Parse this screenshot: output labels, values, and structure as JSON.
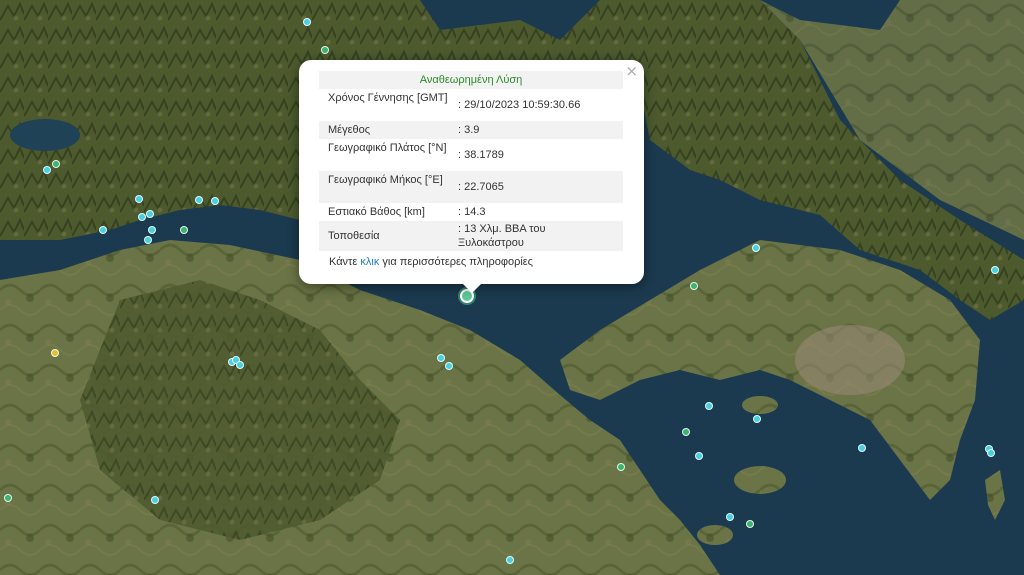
{
  "popup": {
    "title": "Αναθεωρημένη Λύση",
    "close_label": "×",
    "rows": [
      {
        "label": "Χρόνος Γέννησης [GMT]",
        "value": ": 29/10/2023 10:59:30.66"
      },
      {
        "label": "Μέγεθος",
        "value": ": 3.9"
      },
      {
        "label": "Γεωγραφικό Πλάτος [°N]",
        "value": ": 38.1789"
      },
      {
        "label": "Γεωγραφικό Μήκος [°E]",
        "value": ": 22.7065"
      },
      {
        "label": "Εστιακό Βάθος [km]",
        "value": ": 14.3"
      },
      {
        "label": "Τοποθεσία",
        "value": ": 13 Χλμ. ΒΒΑ του Ξυλοκάστρου"
      }
    ],
    "more_prefix": "Κάντε ",
    "more_link": "κλικ",
    "more_suffix": " για περισσότερες πληροφορίες"
  },
  "colors": {
    "sea": "#1b3a4f",
    "land": "#5a6b3a",
    "marker_cyan": "#46d0e0",
    "marker_green": "#3cb371",
    "marker_yellow": "#e0c030",
    "title_green": "#2e8b2e",
    "link_blue": "#1a7fc1"
  },
  "markers": [
    {
      "color": "cyan",
      "name": "earthquake-marker"
    }
  ]
}
